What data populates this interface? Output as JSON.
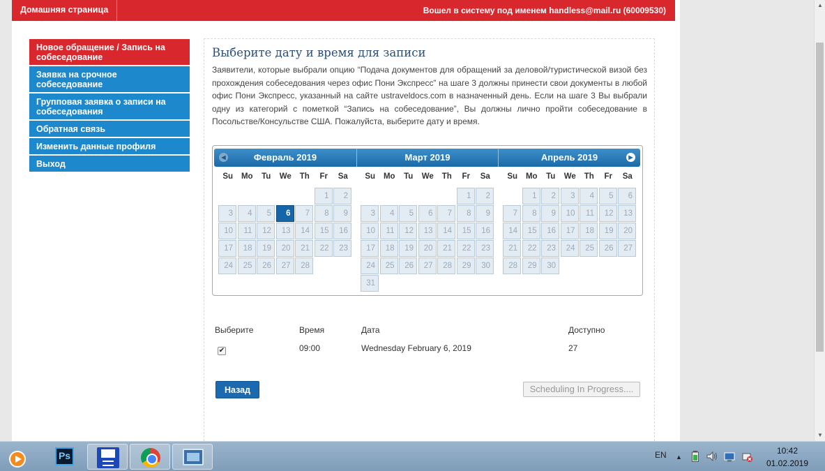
{
  "header": {
    "home": "Домашняя страница",
    "user": "Вошел в систему под именем  handless@mail.ru (60009530)"
  },
  "sidebar": {
    "items": [
      {
        "label": "Новое обращение / Запись на собеседование",
        "active": true
      },
      {
        "label": "Заявка на срочное собеседование",
        "active": false
      },
      {
        "label": "Групповая заявка о записи на собеседования",
        "active": false
      },
      {
        "label": "Обратная связь",
        "active": false
      },
      {
        "label": "Изменить данные профиля",
        "active": false
      },
      {
        "label": "Выход",
        "active": false
      }
    ]
  },
  "main": {
    "title": "Выберите дату и время для записи",
    "intro": "Заявители, которые выбрали опцию “Подача документов для обращений за деловой/туристической визой без прохождения собеседования через офис Пони Экспресс” на шаге 3 должны принести свои документы в любой офис Пони Экспресс, указанный на сайте ustraveldocs.com в назначенный день. Если на шаге 3 Вы выбрали одну из категорий с пометкой “Запись на собеседование”, Вы должны лично пройти собеседование в Посольстве/Консульстве США. Пожалуйста, выберите дату и время."
  },
  "calendar": {
    "weekdays": [
      "Su",
      "Mo",
      "Tu",
      "We",
      "Th",
      "Fr",
      "Sa"
    ],
    "months": [
      {
        "title": "Февраль 2019",
        "first_weekday": 5,
        "days": 28,
        "selected": 6
      },
      {
        "title": "Март 2019",
        "first_weekday": 5,
        "days": 31,
        "selected": null
      },
      {
        "title": "Апрель 2019",
        "first_weekday": 1,
        "days": 30,
        "selected": null
      }
    ],
    "prev_icon": "prev-arrow-icon",
    "next_icon": "next-arrow-icon"
  },
  "table": {
    "headers": {
      "select": "Выберите",
      "time": "Время",
      "date": "Дата",
      "available": "Доступно"
    },
    "row": {
      "checked": true,
      "time": "09:00",
      "date": "Wednesday February 6, 2019",
      "available": "27"
    }
  },
  "buttons": {
    "back": "Назад",
    "scheduling": "Scheduling In Progress...."
  },
  "taskbar": {
    "lang": "EN",
    "time": "10:42",
    "date": "01.02.2019",
    "apps": [
      "media-player-icon",
      "photoshop-icon",
      "save-disk-icon",
      "chrome-icon",
      "remote-desktop-icon"
    ],
    "ps_label": "Ps"
  },
  "colors": {
    "brand_red": "#d9272e",
    "nav_blue": "#1e88cd",
    "selected_day": "#1565a8"
  }
}
